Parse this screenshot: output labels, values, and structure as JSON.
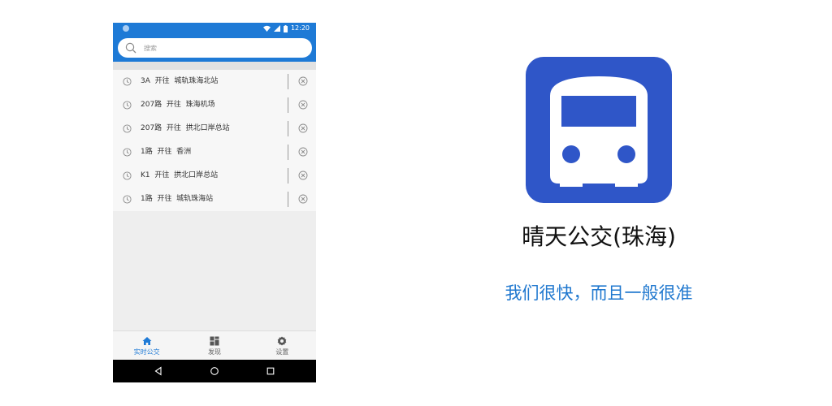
{
  "colors": {
    "primary": "#1e7ad6",
    "brand_icon_bg": "#2f56c8",
    "slogan": "#2078cf"
  },
  "status_bar": {
    "time": "12:20"
  },
  "search": {
    "placeholder": "搜索",
    "icon": "search-icon"
  },
  "history": [
    {
      "text": "3A  开往  城轨珠海北站"
    },
    {
      "text": "207路  开往  珠海机场"
    },
    {
      "text": "207路  开往  拱北口岸总站"
    },
    {
      "text": "1路  开往  香洲"
    },
    {
      "text": "K1  开往  拱北口岸总站"
    },
    {
      "text": "1路  开往  城轨珠海站"
    }
  ],
  "tabs": [
    {
      "label": "实时公交",
      "icon": "home-icon",
      "active": true
    },
    {
      "label": "发现",
      "icon": "grid-icon",
      "active": false
    },
    {
      "label": "设置",
      "icon": "gear-icon",
      "active": false
    }
  ],
  "app": {
    "title": "晴天公交(珠海)",
    "slogan": "我们很快，而且一般很准",
    "icon": "bus-icon"
  }
}
